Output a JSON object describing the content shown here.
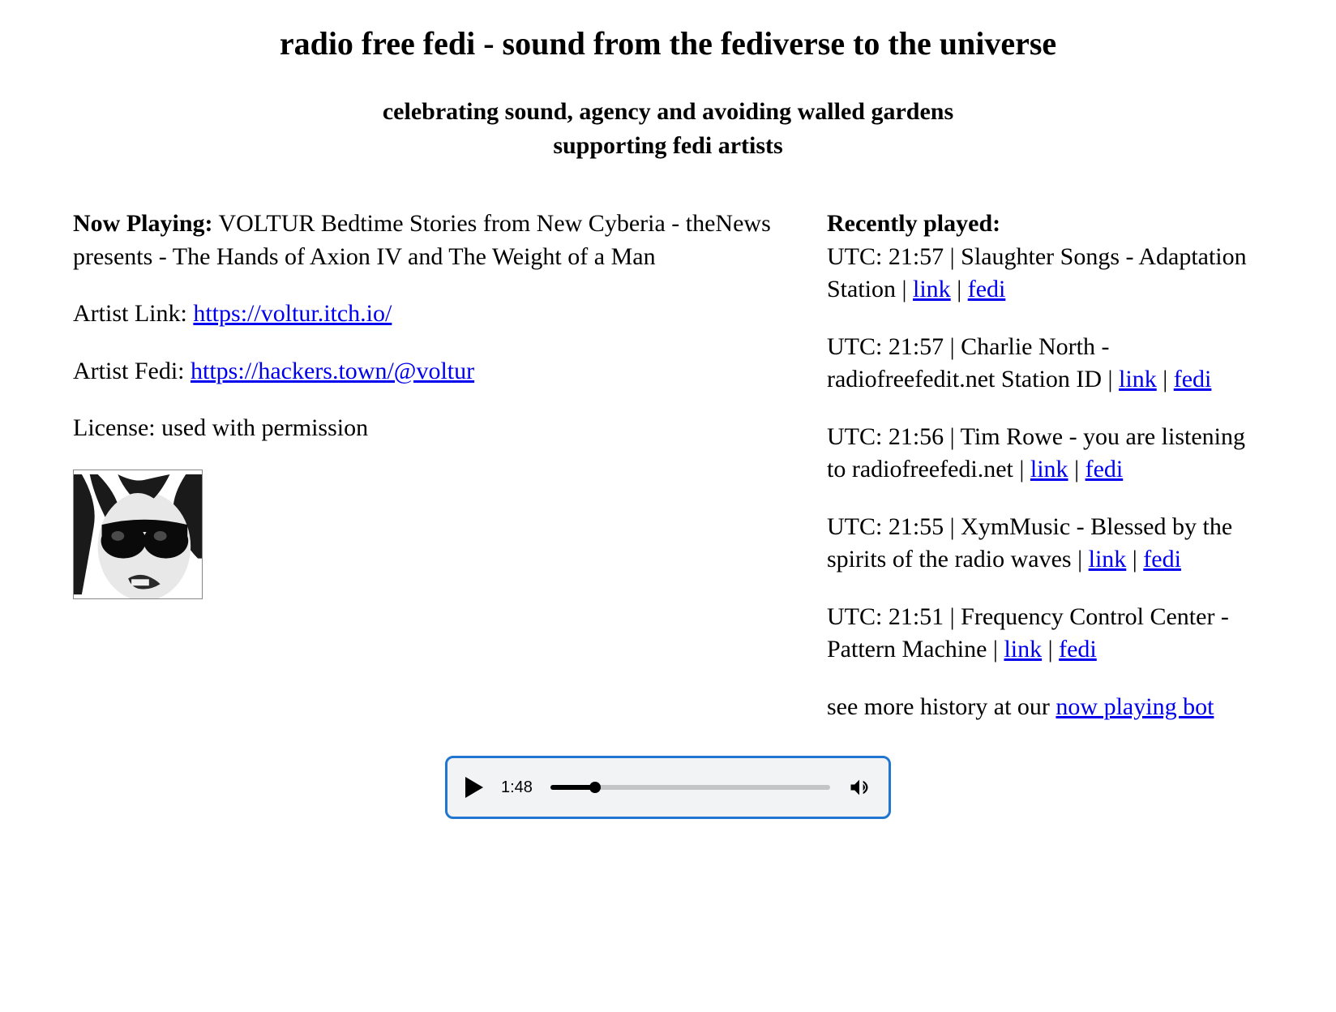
{
  "header": {
    "title": "radio free fedi - sound from the fediverse to the universe",
    "subtitle_line1": "celebrating sound, agency and avoiding walled gardens",
    "subtitle_line2": "supporting fedi artists"
  },
  "now_playing": {
    "label": "Now Playing:",
    "track": "VOLTUR Bedtime Stories from New Cyberia - theNews presents - The Hands of Axion IV and The Weight of a Man",
    "artist_link_label": "Artist Link: ",
    "artist_link_url": "https://voltur.itch.io/",
    "artist_fedi_label": "Artist Fedi: ",
    "artist_fedi_url": "https://hackers.town/@voltur",
    "license_label": "License: ",
    "license_value": "used with permission"
  },
  "recent": {
    "label": "Recently played:",
    "items": [
      {
        "line": "UTC: 21:57 | Slaughter Songs - Adaptation Station | ",
        "link_label": "link",
        "sep": " | ",
        "fedi_label": "fedi"
      },
      {
        "line": "UTC: 21:57 | Charlie North - radiofreefedit.net Station ID | ",
        "link_label": "link",
        "sep": " | ",
        "fedi_label": "fedi"
      },
      {
        "line": "UTC: 21:56 | Tim Rowe - you are listening to radiofreefedi.net | ",
        "link_label": "link",
        "sep": " | ",
        "fedi_label": "fedi"
      },
      {
        "line": "UTC: 21:55 | XymMusic - Blessed by the spirits of the radio waves | ",
        "link_label": "link",
        "sep": " | ",
        "fedi_label": "fedi"
      },
      {
        "line": "UTC: 21:51 | Frequency Control Center - Pattern Machine | ",
        "link_label": "link",
        "sep": " | ",
        "fedi_label": "fedi"
      }
    ],
    "history_prefix": "see more history at our ",
    "history_link": "now playing bot"
  },
  "player": {
    "time": "1:48"
  }
}
